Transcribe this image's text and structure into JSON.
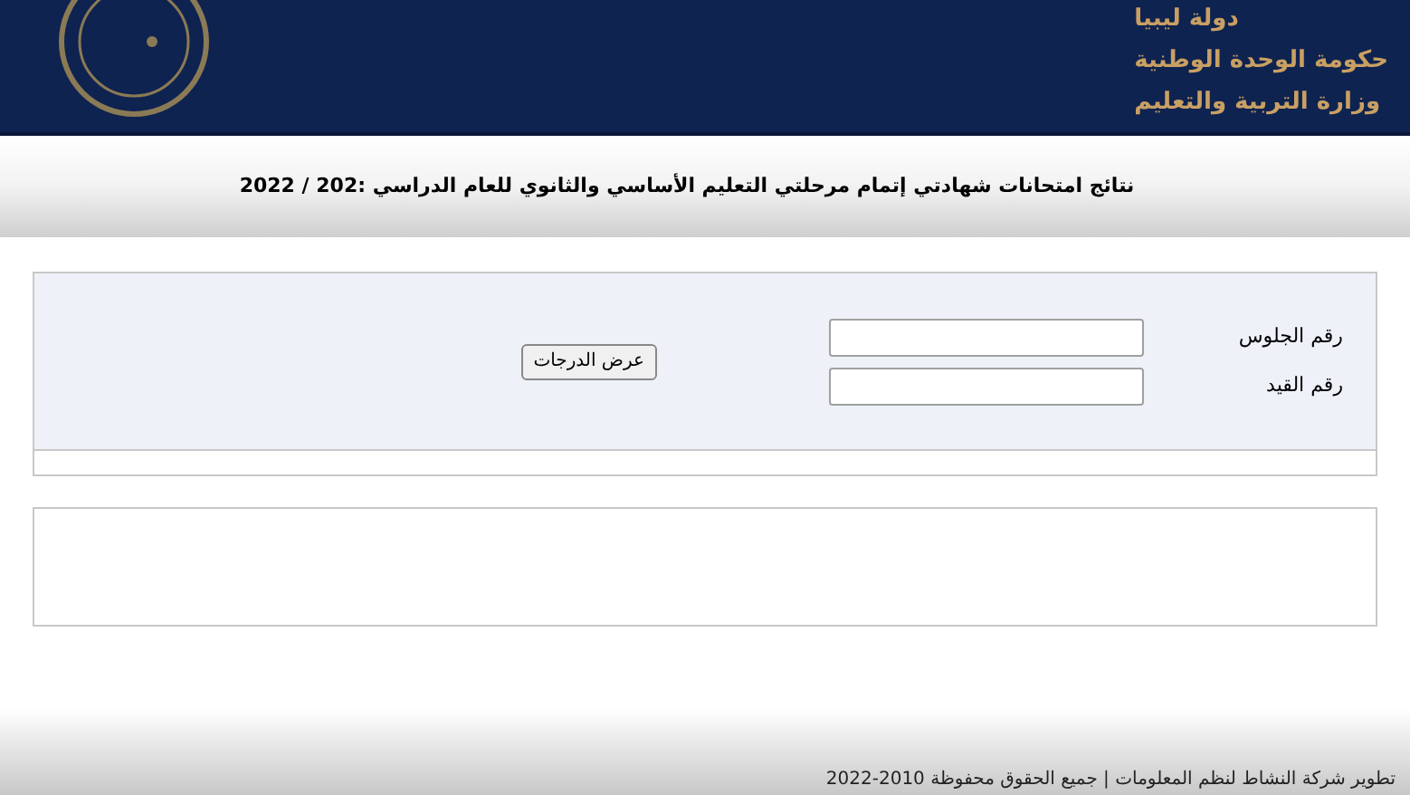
{
  "header": {
    "lines": [
      "دولة ليبيا",
      "حكومة الوحدة الوطنية",
      "وزارة التربية والتعليم"
    ]
  },
  "title": "نتائج امتحانات شهادتي إتمام مرحلتي التعليم الأساسي والثانوي للعام الدراسي :202 / 2022",
  "form": {
    "fields": [
      {
        "label": "رقم الجلوس"
      },
      {
        "label": "رقم القيد"
      }
    ],
    "button": "عرض الدرجات"
  },
  "footer": "تطوير شركة النشاط لنظم المعلومات | جميع الحقوق محفوظة 2010-2022"
}
